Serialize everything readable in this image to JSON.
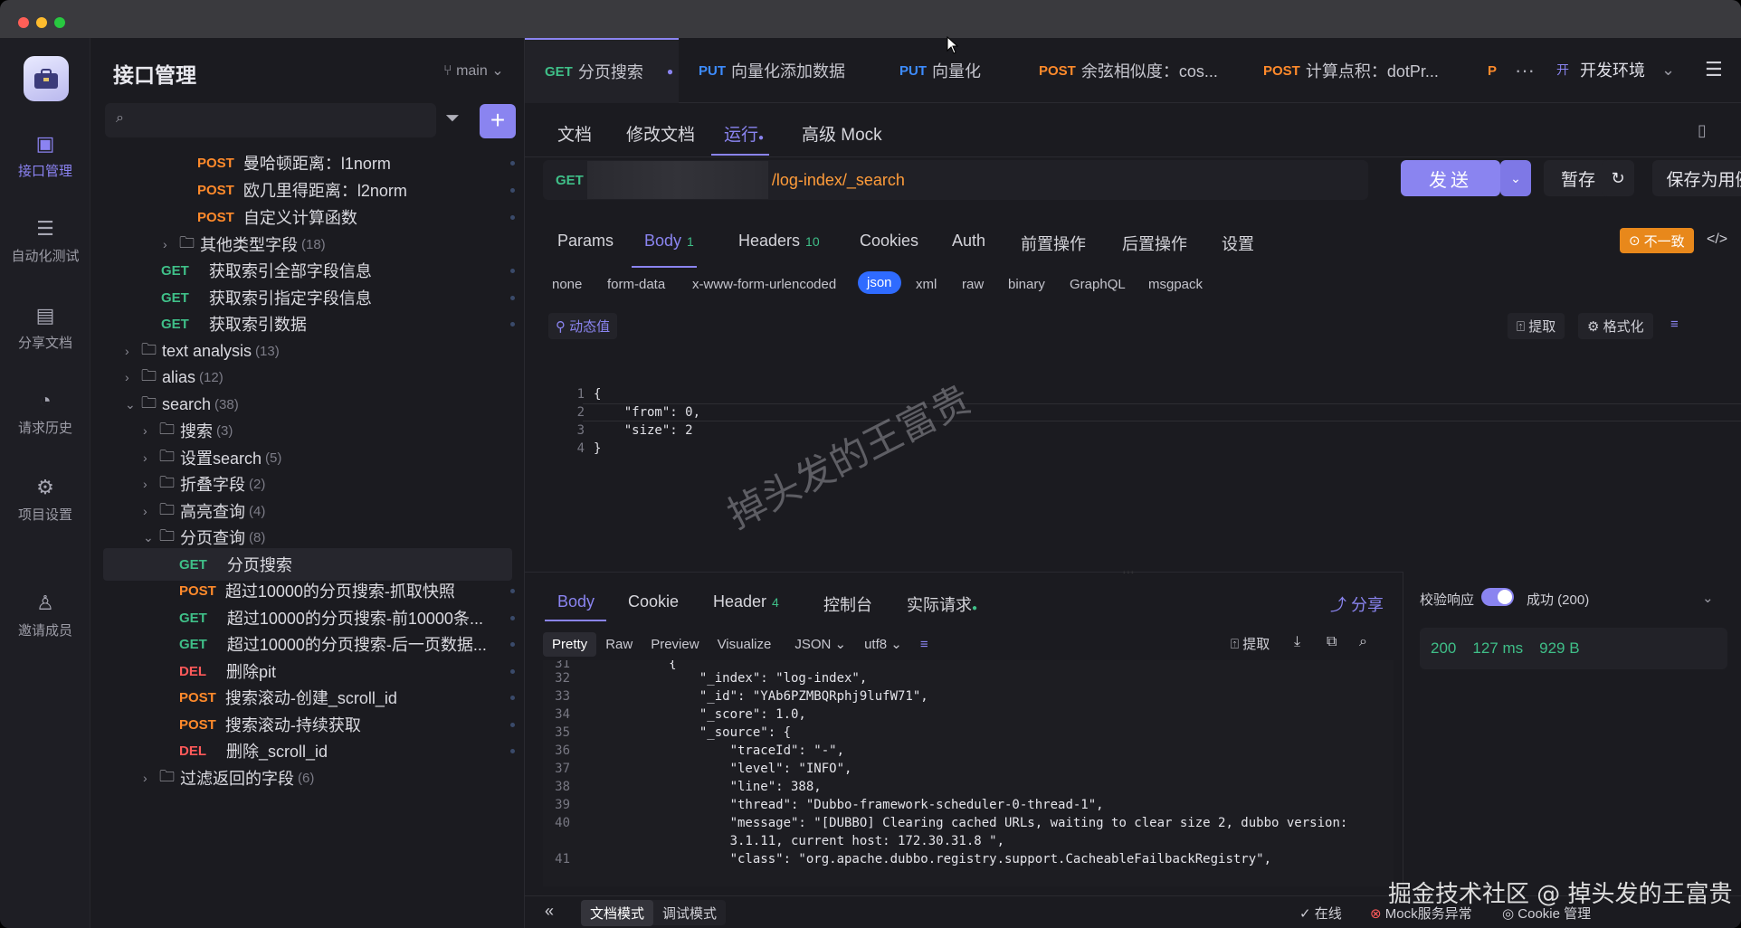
{
  "app": {
    "sidebar_title": "接口管理",
    "branch": "main",
    "search_placeholder": ""
  },
  "rail": [
    {
      "label": "接口管理",
      "icon": "api-icon"
    },
    {
      "label": "自动化测试",
      "icon": "stack-icon"
    },
    {
      "label": "分享文档",
      "icon": "doc-share-icon"
    },
    {
      "label": "请求历史",
      "icon": "history-icon"
    },
    {
      "label": "项目设置",
      "icon": "settings-icon"
    },
    {
      "label": "邀请成员",
      "icon": "user-plus-icon"
    }
  ],
  "tree": [
    {
      "method": "POST",
      "label": "曼哈顿距离：l1norm"
    },
    {
      "method": "POST",
      "label": "欧几里得距离：l2norm"
    },
    {
      "method": "POST",
      "label": "自定义计算函数"
    },
    {
      "folder": "其他类型字段",
      "count": "(18)"
    },
    {
      "method": "GET",
      "label": "获取索引全部字段信息"
    },
    {
      "method": "GET",
      "label": "获取索引指定字段信息"
    },
    {
      "method": "GET",
      "label": "获取索引数据"
    },
    {
      "folder": "text analysis",
      "count": "(13)"
    },
    {
      "folder": "alias",
      "count": "(12)"
    },
    {
      "folder": "search",
      "count": "(38)"
    },
    {
      "folder": "搜索",
      "count": "(3)"
    },
    {
      "folder": "设置search",
      "count": "(5)"
    },
    {
      "folder": "折叠字段",
      "count": "(2)"
    },
    {
      "folder": "高亮查询",
      "count": "(4)"
    },
    {
      "folder": "分页查询",
      "count": "(8)"
    },
    {
      "method": "GET",
      "label": "分页搜索"
    },
    {
      "method": "POST",
      "label": "超过10000的分页搜索-抓取快照"
    },
    {
      "method": "GET",
      "label": "超过10000的分页搜索-前10000条..."
    },
    {
      "method": "GET",
      "label": "超过10000的分页搜索-后一页数据..."
    },
    {
      "method": "DEL",
      "label": "删除pit"
    },
    {
      "method": "POST",
      "label": "搜索滚动-创建_scroll_id"
    },
    {
      "method": "POST",
      "label": "搜索滚动-持续获取"
    },
    {
      "method": "DEL",
      "label": "删除_scroll_id"
    },
    {
      "folder": "过滤返回的字段",
      "count": "(6)"
    }
  ],
  "tabs": [
    {
      "method": "GET",
      "label": "分页搜索"
    },
    {
      "method": "PUT",
      "label": "向量化添加数据"
    },
    {
      "method": "PUT",
      "label": "向量化"
    },
    {
      "method": "POST",
      "label": "余弦相似度：cos..."
    },
    {
      "method": "POST",
      "label": "计算点积：dotPr..."
    },
    {
      "method": "P",
      "label": ""
    }
  ],
  "env": {
    "badge": "开",
    "label": "开发环境"
  },
  "subtabs": [
    "文档",
    "修改文档",
    "运行",
    "高级 Mock"
  ],
  "request": {
    "method": "GET",
    "url": "/log-index/_search",
    "send": "发送",
    "save": "暂存",
    "save_case": "保存为用例"
  },
  "reqtabs": [
    {
      "label": "Params"
    },
    {
      "label": "Body",
      "count": "1"
    },
    {
      "label": "Headers",
      "count": "10"
    },
    {
      "label": "Cookies"
    },
    {
      "label": "Auth"
    },
    {
      "label": "前置操作"
    },
    {
      "label": "后置操作"
    },
    {
      "label": "设置"
    }
  ],
  "mismatch": "不一致",
  "bodytypes": [
    "none",
    "form-data",
    "x-www-form-urlencoded",
    "json",
    "xml",
    "raw",
    "binary",
    "GraphQL",
    "msgpack"
  ],
  "editor": {
    "dynamic": "动态值",
    "extract": "提取",
    "format": "格式化",
    "lines": [
      "{",
      "    \"from\": 0,",
      "    \"size\": 2",
      "}"
    ]
  },
  "watermark": "掉头发的王富贵",
  "response": {
    "tabs": [
      "Body",
      "Cookie",
      "Header",
      "控制台",
      "实际请求"
    ],
    "header_count": "4",
    "share": "分享",
    "views": [
      "Pretty",
      "Raw",
      "Preview",
      "Visualize"
    ],
    "format": "JSON",
    "encoding": "utf8",
    "extract": "提取",
    "lines": [
      {
        "n": "31",
        "t": "            {"
      },
      {
        "n": "32",
        "t": "                \"_index\": \"log-index\","
      },
      {
        "n": "33",
        "t": "                \"_id\": \"YAb6PZMBQRphj9lufW71\","
      },
      {
        "n": "34",
        "t": "                \"_score\": 1.0,"
      },
      {
        "n": "35",
        "t": "                \"_source\": {"
      },
      {
        "n": "36",
        "t": "                    \"traceId\": \"-\","
      },
      {
        "n": "37",
        "t": "                    \"level\": \"INFO\","
      },
      {
        "n": "38",
        "t": "                    \"line\": 388,"
      },
      {
        "n": "39",
        "t": "                    \"thread\": \"Dubbo-framework-scheduler-0-thread-1\","
      },
      {
        "n": "40",
        "t": "                    \"message\": \"[DUBBO] Clearing cached URLs, waiting to clear size 2, dubbo version:"
      },
      {
        "n": "",
        "t": "                    3.1.11, current host: 172.30.31.8 \","
      },
      {
        "n": "41",
        "t": "                    \"class\": \"org.apache.dubbo.registry.support.CacheableFailbackRegistry\","
      }
    ]
  },
  "validate": {
    "label": "校验响应",
    "result": "成功 (200)",
    "status": "200",
    "time": "127 ms",
    "size": "929 B"
  },
  "bottom": {
    "doc_mode": "文档模式",
    "debug_mode": "调试模式",
    "online": "在线",
    "mock": "Mock服务异常",
    "cookie": "Cookie 管理"
  },
  "credit": "掘金技术社区 @ 掉头发的王富贵"
}
